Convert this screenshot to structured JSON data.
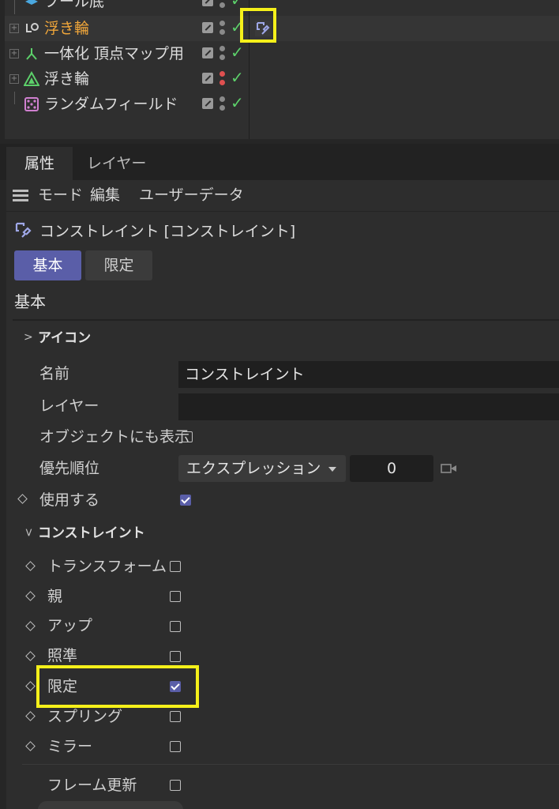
{
  "object_manager": {
    "rows": [
      {
        "name": "プール底",
        "selected": false
      },
      {
        "name": "浮き輪",
        "selected": true
      },
      {
        "name": "一体化 頂点マップ用",
        "selected": false
      },
      {
        "name": "浮き輪",
        "selected": false
      },
      {
        "name": "ランダムフィールド",
        "selected": false
      }
    ]
  },
  "tabs": {
    "attributes": "属性",
    "layer": "レイヤー"
  },
  "menu": {
    "mode": "モード",
    "edit": "編集",
    "userdata": "ユーザーデータ"
  },
  "object_title": "コンストレイント [コンストレイント]",
  "page_buttons": {
    "basic": "基本",
    "limit": "限定"
  },
  "section_title": "基本",
  "groups": {
    "icon": "アイコン",
    "constraint": "コンストレイント"
  },
  "fields": {
    "name_label": "名前",
    "name_value": "コンストレイント",
    "layer_label": "レイヤー",
    "layer_value": "",
    "show_on_object_label": "オブジェクトにも表示",
    "priority_label": "優先順位",
    "priority_mode": "エクスプレッション",
    "priority_value": "0",
    "enable_label": "使用する"
  },
  "constraints": [
    {
      "label": "トランスフォーム",
      "checked": false
    },
    {
      "label": "親",
      "checked": false
    },
    {
      "label": "アップ",
      "checked": false
    },
    {
      "label": "照準",
      "checked": false
    },
    {
      "label": "限定",
      "checked": true
    },
    {
      "label": "スプリング",
      "checked": false
    },
    {
      "label": "ミラー",
      "checked": false
    }
  ],
  "frame_update_label": "フレーム更新",
  "colors": {
    "accent": "#5a5ea8",
    "highlight": "#f5f01a",
    "selected_object": "#f0a63a",
    "check_green": "#5cd06a"
  }
}
